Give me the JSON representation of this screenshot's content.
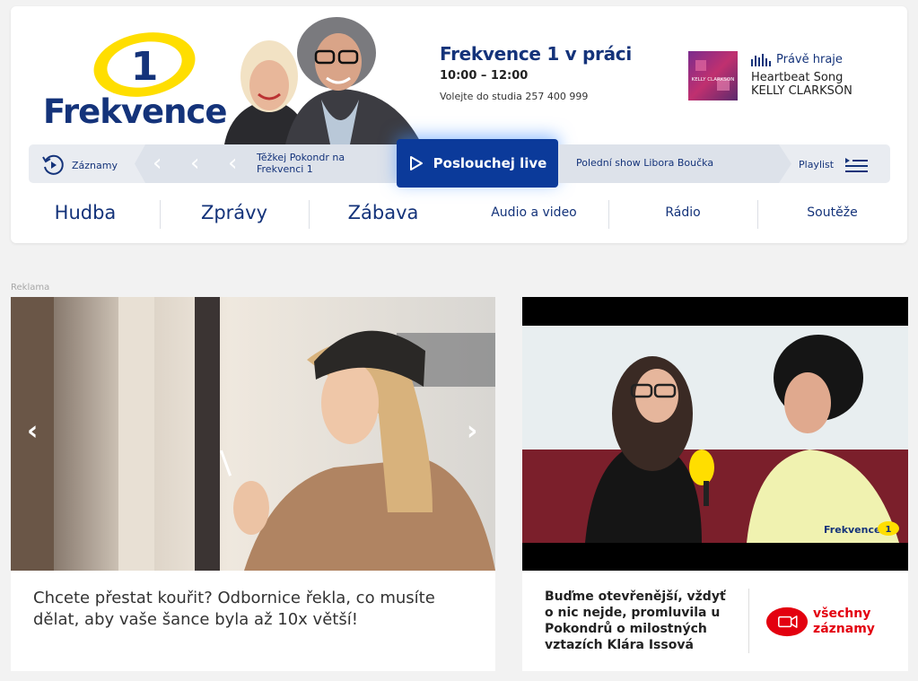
{
  "brand": {
    "logo_number": "1",
    "logo_name": "Frekvence",
    "navy": "#14337a",
    "live_blue": "#0b3a9a",
    "accent_yellow": "#ffde00",
    "red": "#e3000f"
  },
  "show": {
    "title": "Frekvence 1 v práci",
    "time": "10:00 – 12:00",
    "phone": "Volejte do studia 257 400 999"
  },
  "now_playing": {
    "label": "Právě hraje",
    "song": "Heartbeat Song",
    "artist": "KELLY CLARKSON",
    "cover_text": "KELLY CLARKSON"
  },
  "player": {
    "records_label": "Záznamy",
    "previous_show": "Těžkej Pokondr na Frekvenci 1",
    "live_label": "Poslouchej live",
    "next_show": "Polední show Libora Boučka",
    "playlist_label": "Playlist"
  },
  "nav": {
    "main": [
      "Hudba",
      "Zprávy",
      "Zábava"
    ],
    "secondary": [
      "Audio a video",
      "Rádio",
      "Soutěže"
    ]
  },
  "ad_label": "Reklama",
  "left_article": {
    "title": "Chcete přestat kouřit? Odbornice řekla, co musíte dělat, aby vaše šance byla až 10x větší!"
  },
  "right_article": {
    "title": "Buďme otevřenější, vždyť o nic nejde, promluvila u Pokondrů o milostných vztazích Klára Issová",
    "watermark": "Frekvence",
    "watermark_number": "1",
    "all_records": "všechny záznamy"
  }
}
